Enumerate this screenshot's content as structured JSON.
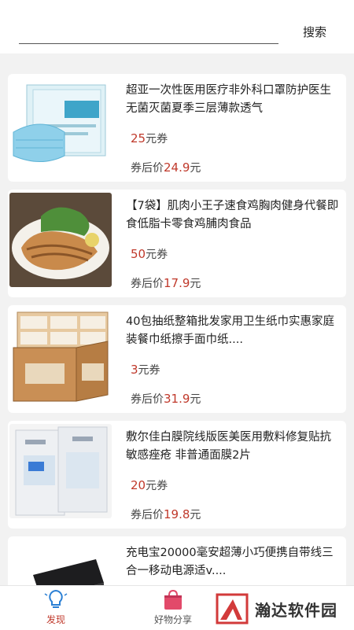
{
  "header": {
    "search_placeholder": "",
    "search_label": "搜索"
  },
  "products": [
    {
      "title": "超亚一次性医用医疗非外科口罩防护医生无菌灭菌夏季三层薄款透气",
      "coupon_value": "25",
      "coupon_unit": "元券",
      "after_label": "券后价",
      "price": "24.9",
      "price_unit": "元",
      "image": "medical-masks-box"
    },
    {
      "title": "【7袋】肌肉小王子速食鸡胸肉健身代餐即食低脂卡零食鸡脯肉食品",
      "coupon_value": "50",
      "coupon_unit": "元券",
      "after_label": "券后价",
      "price": "17.9",
      "price_unit": "元",
      "image": "grilled-chicken-breast"
    },
    {
      "title": "40包抽纸整箱批发家用卫生纸巾实惠家庭装餐巾纸擦手面巾纸....",
      "coupon_value": "3",
      "coupon_unit": "元券",
      "after_label": "券后价",
      "price": "31.9",
      "price_unit": "元",
      "image": "tissue-box"
    },
    {
      "title": "敷尔佳白膜院线版医美医用敷料修复贴抗敏感痤疮 非普通面膜2片",
      "coupon_value": "20",
      "coupon_unit": "元券",
      "after_label": "券后价",
      "price": "19.8",
      "price_unit": "元",
      "image": "face-mask-packs"
    },
    {
      "title": "充电宝20000毫安超薄小巧便携自带线三合一移动电源适v....",
      "coupon_value": "",
      "coupon_unit": "",
      "after_label": "",
      "price": "",
      "price_unit": "",
      "image": "power-bank"
    }
  ],
  "tabs": [
    {
      "label": "发现",
      "icon": "bulb-icon",
      "active": true
    },
    {
      "label": "好物分享",
      "icon": "shopping-bag-icon",
      "active": false
    }
  ],
  "watermark": {
    "text": "瀚达软件园"
  },
  "colors": {
    "accent": "#c0392b",
    "background": "#f2f2f2"
  }
}
